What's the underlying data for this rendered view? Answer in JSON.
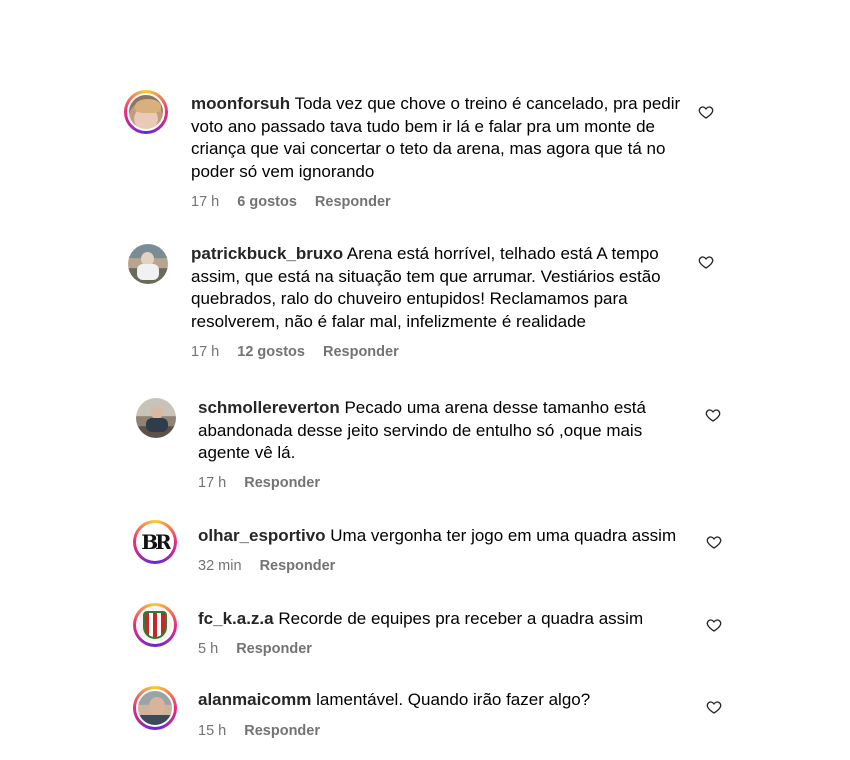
{
  "comments": [
    {
      "username": "moonforsuh",
      "text": "Toda vez que chove o treino é cancelado, pra pedir voto ano passado tava tudo bem ir lá e falar pra um monte de criança que vai concertar o teto da arena, mas agora que tá no poder só vem ignorando",
      "time": "17 h",
      "likes": "6 gostos",
      "reply": "Responder",
      "avatar": "photo-girl",
      "story_ring": true
    },
    {
      "username": "patrickbuck_bruxo",
      "text": "Arena está horrível, telhado está A tempo assim, que está na situação tem que arrumar. Vestiários estão quebrados, ralo do chuveiro entupidos! Reclamamos para resolverem, não é falar mal, infelizmente é realidade",
      "time": "17 h",
      "likes": "12 gostos",
      "reply": "Responder",
      "avatar": "photo-man-outdoor",
      "story_ring": false
    },
    {
      "username": "schmollereverton",
      "text": "Pecado uma arena desse tamanho está abandonada desse jeito servindo de entulho só ,oque mais agente vê lá.",
      "time": "17 h",
      "likes": "",
      "reply": "Responder",
      "avatar": "photo-man-indoor",
      "story_ring": false
    },
    {
      "username": "olhar_esportivo",
      "text": "Uma vergonha ter jogo em uma quadra assim",
      "time": "32 min",
      "likes": "",
      "reply": "Responder",
      "avatar": "logo-br-monogram",
      "story_ring": true
    },
    {
      "username": "fc_k.a.z.a",
      "text": "Recorde de equipes pra receber a quadra assim",
      "time": "5 h",
      "likes": "",
      "reply": "Responder",
      "avatar": "logo-club-crest",
      "story_ring": true
    },
    {
      "username": "alanmaicomm",
      "text": "lamentável. Quando irão fazer algo?",
      "time": "15 h",
      "likes": "",
      "reply": "Responder",
      "avatar": "photo-man-portrait",
      "story_ring": true
    }
  ],
  "colors": {
    "text": "#000000",
    "username": "#262626",
    "meta": "#737373",
    "ring_start": "#f9ce34",
    "ring_mid": "#ee2a7b",
    "ring_end": "#6228d7"
  },
  "icons": {
    "like": "heart-outline-icon"
  }
}
